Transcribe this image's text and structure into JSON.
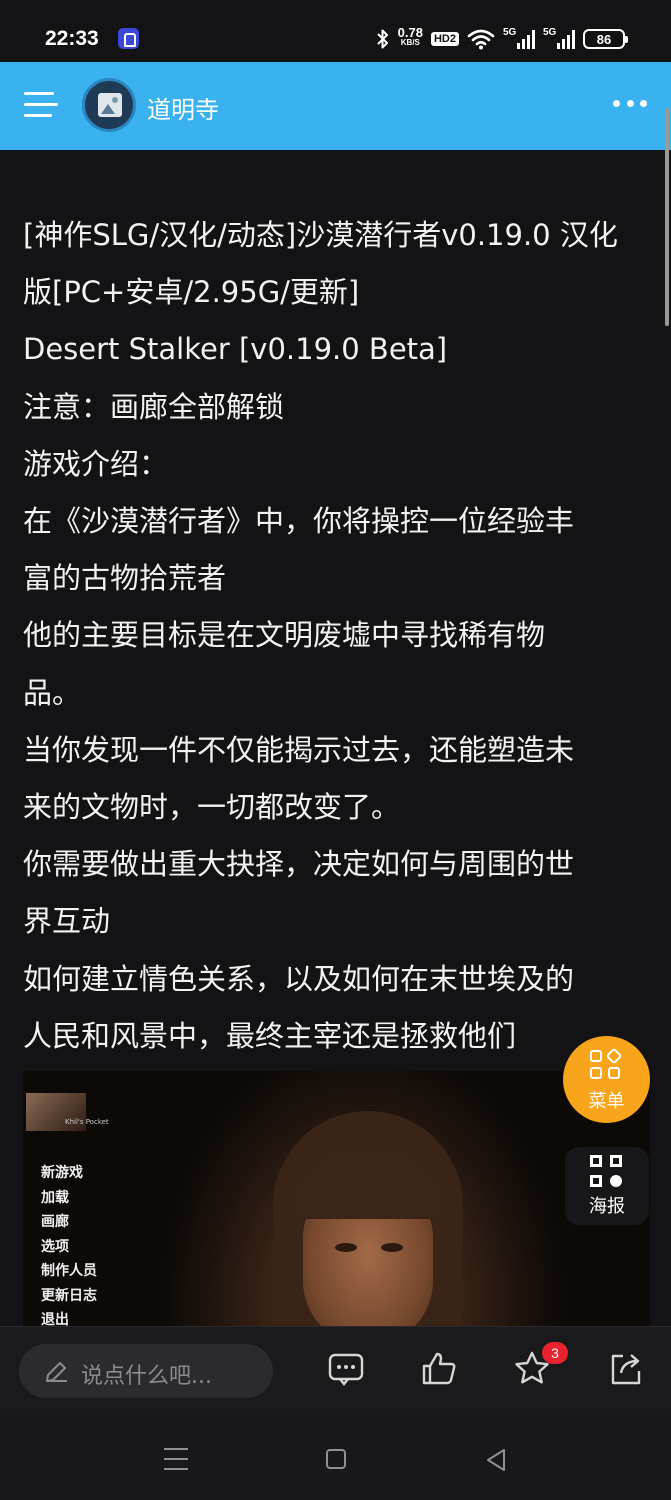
{
  "status_bar": {
    "time": "22:33",
    "net_speed": "0.78",
    "net_unit": "KB/S",
    "hd": "HD2",
    "sim1": "5G",
    "sim2": "5G",
    "battery": "86",
    "icons": [
      "app-notification-icon",
      "bluetooth-icon",
      "wifi-icon",
      "signal-icon",
      "battery-icon"
    ]
  },
  "header": {
    "channel_name": "道明寺",
    "background_color": "#3ab2ef"
  },
  "article": {
    "lines": [
      "[神作SLG/汉化/动态]沙漠潜行者v0.19.0 汉化",
      "版[PC+安卓/2.95G/更新]",
      "Desert Stalker [v0.19.0 Beta]",
      "注意：画廊全部解锁",
      "游戏介绍：",
      "在《沙漠潜行者》中，你将操控一位经验丰",
      "富的古物拾荒者",
      "他的主要目标是在文明废墟中寻找稀有物",
      "品。",
      "当你发现一件不仅能揭示过去，还能塑造未",
      "来的文物时，一切都改变了。",
      "你需要做出重大抉择，决定如何与周围的世",
      "界互动",
      "如何建立情色关系，以及如何在末世埃及的",
      "人民和风景中，最终主宰还是拯救他们"
    ]
  },
  "screenshot": {
    "logo_text": "Khil's Pocket",
    "game_menu": [
      "新游戏",
      "加载",
      "画廊",
      "选项",
      "制作人员",
      "更新日志",
      "退出"
    ]
  },
  "floating": {
    "menu_label": "菜单",
    "poster_label": "海报",
    "accent_color": "#f9a51c"
  },
  "bottom_bar": {
    "comment_placeholder": "说点什么吧...",
    "favorite_badge": "3",
    "actions": [
      "comment-icon",
      "like-icon",
      "favorite-icon",
      "share-icon"
    ]
  }
}
